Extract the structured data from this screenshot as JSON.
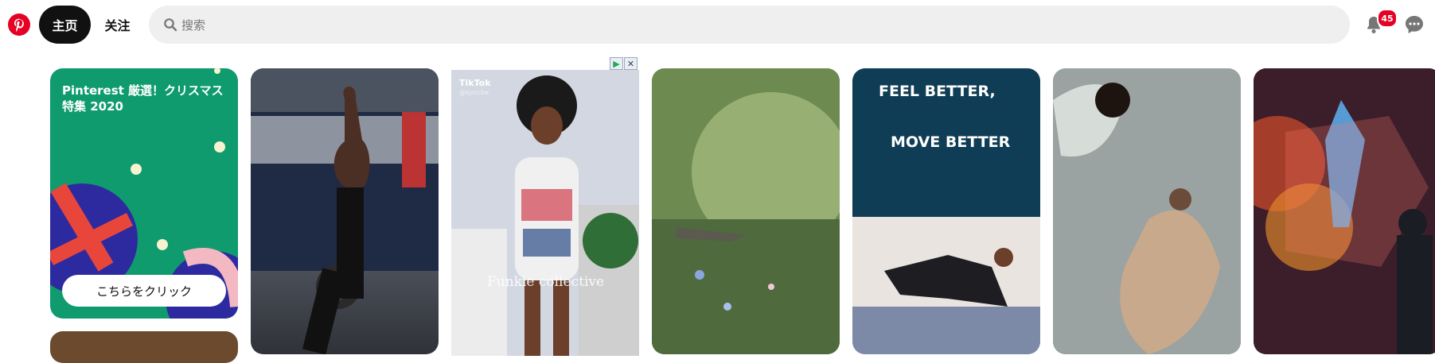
{
  "header": {
    "logo_icon": "pinterest-logo",
    "tabs": [
      {
        "label": "主页",
        "active": true
      },
      {
        "label": "关注",
        "active": false
      }
    ],
    "search_placeholder": "搜索",
    "notification_count": "45",
    "icons": [
      "search-icon",
      "bell-icon",
      "chat-icon"
    ]
  },
  "pins": [
    {
      "kind": "promo",
      "title": "Pinterest 厳選！クリスマス特集 2020",
      "button_label": "こちらをクリック"
    },
    {
      "kind": "image",
      "desc": ""
    },
    {
      "kind": "ad",
      "brand": "TikTok",
      "handle": "@kjmcbe",
      "overlay": "Funkie collective"
    },
    {
      "kind": "image"
    },
    {
      "kind": "image",
      "line1": "FEEL BETTER,",
      "line2": "MOVE BETTER"
    },
    {
      "kind": "image"
    },
    {
      "kind": "image"
    }
  ],
  "colors": {
    "brand_red": "#e60023",
    "active_tab_bg": "#111111",
    "search_bg": "#efefef"
  }
}
